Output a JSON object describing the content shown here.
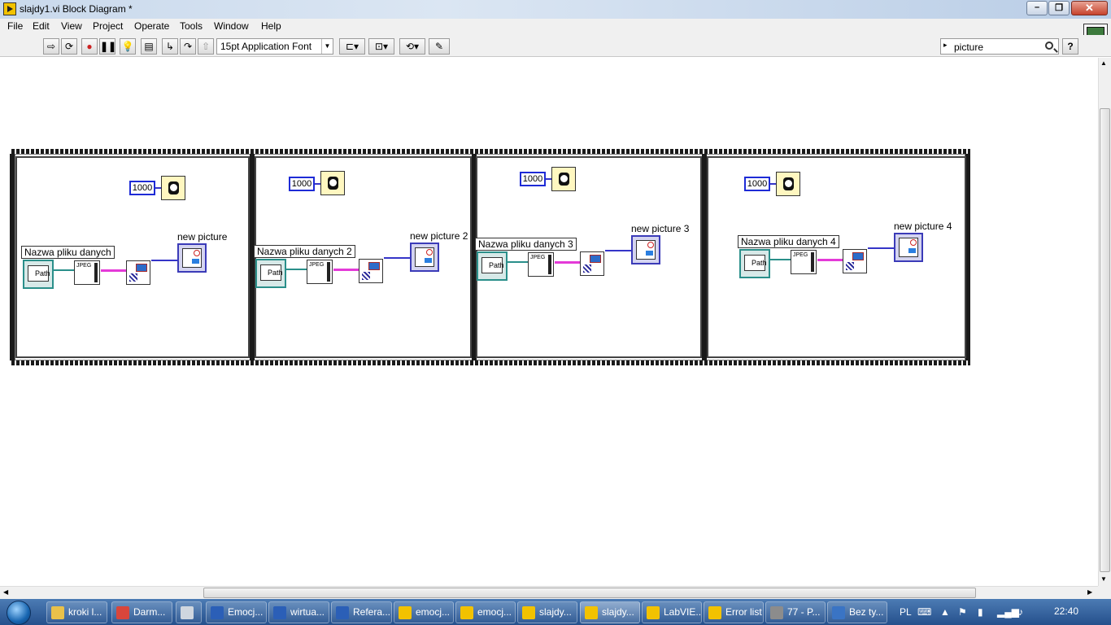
{
  "window": {
    "title": "slajdy1.vi Block Diagram *",
    "close_symbol": "✕",
    "minimize_symbol": "–",
    "maximize_symbol": "❐"
  },
  "menu": [
    "File",
    "Edit",
    "View",
    "Project",
    "Operate",
    "Tools",
    "Window",
    "Help"
  ],
  "toolbar": {
    "font": "15pt Application Font",
    "search_value": "picture",
    "help_symbol": "?",
    "vi_icon_number": "1"
  },
  "frames": [
    {
      "wait_ms": "1000",
      "file_label": "Nazwa pliku danych",
      "path_label": "Path",
      "jpeg_label": "JPEG",
      "picture_label": "new picture"
    },
    {
      "wait_ms": "1000",
      "file_label": "Nazwa pliku danych  2",
      "path_label": "Path",
      "jpeg_label": "JPEG",
      "picture_label": "new picture 2"
    },
    {
      "wait_ms": "1000",
      "file_label": "Nazwa pliku danych  3",
      "path_label": "Path",
      "jpeg_label": "JPEG",
      "picture_label": "new picture 3"
    },
    {
      "wait_ms": "1000",
      "file_label": "Nazwa pliku danych  4",
      "path_label": "Path",
      "jpeg_label": "JPEG",
      "picture_label": "new picture 4"
    }
  ],
  "taskbar": {
    "items": [
      "kroki l...",
      "Darm...",
      "",
      "Emocj...",
      "wirtua...",
      "Refera...",
      "emocj...",
      "emocj...",
      "slajdy...",
      "slajdy...",
      "LabVIE...",
      "Error list",
      "77 - P...",
      "Bez ty..."
    ],
    "icon_colors": [
      "#e9c14a",
      "#d9463b",
      "#cfd6df",
      "#2b5fb7",
      "#2b5fb7",
      "#2b5fb7",
      "#f2c200",
      "#f2c200",
      "#f2c200",
      "#f2c200",
      "#f2c200",
      "#f2c200",
      "#8c8c8c",
      "#3a74c4"
    ],
    "language": "PL",
    "clock": "22:40"
  }
}
